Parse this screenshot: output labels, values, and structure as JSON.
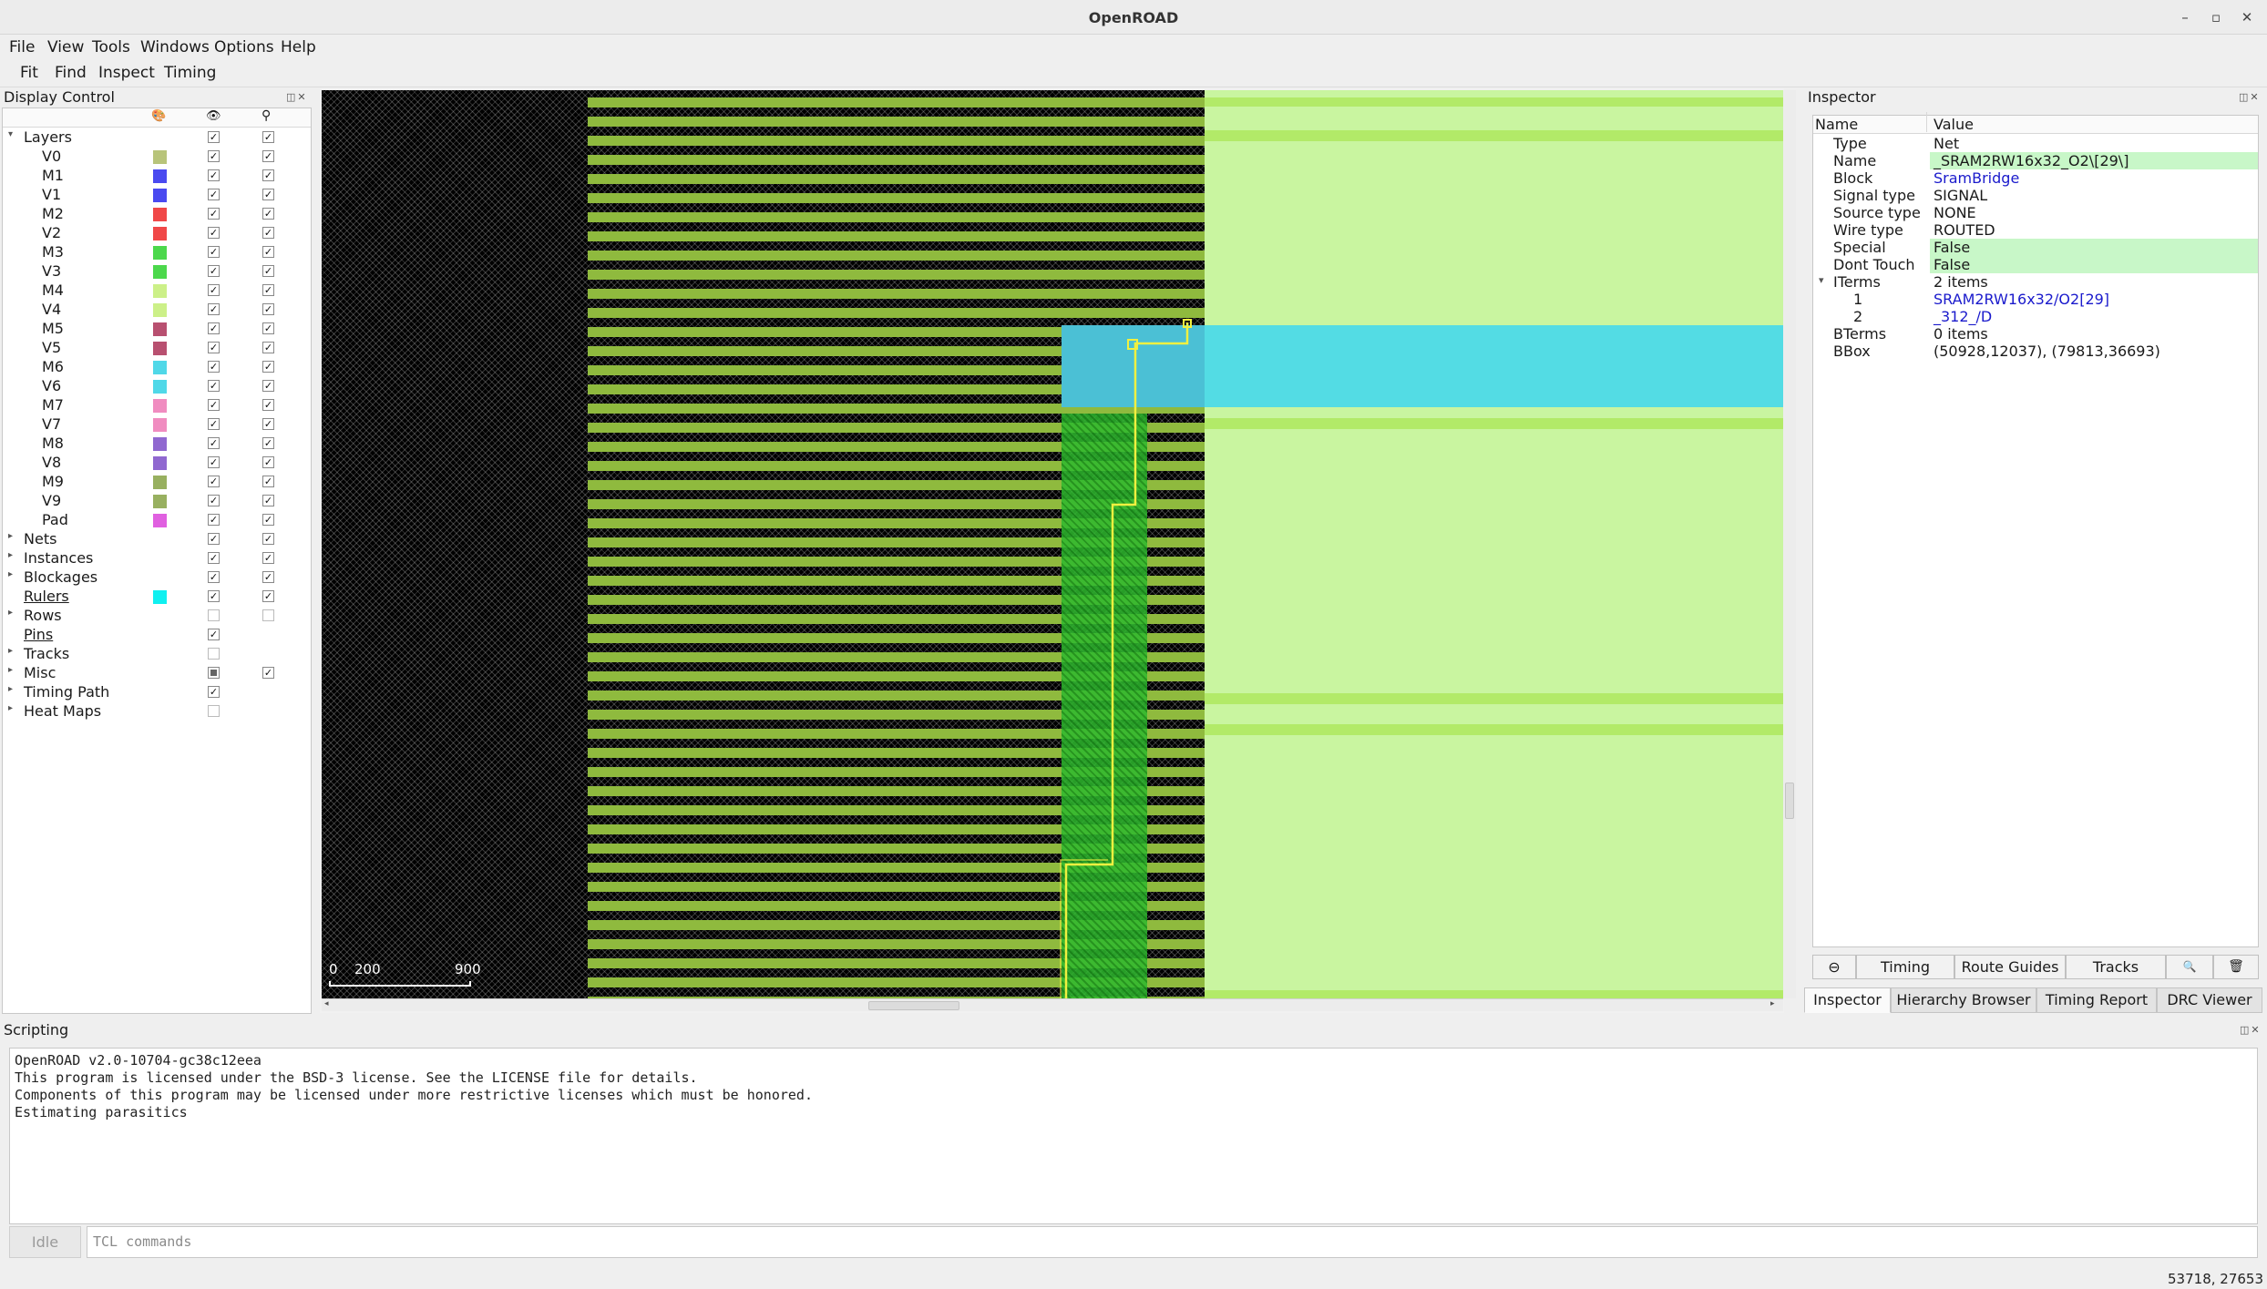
{
  "window": {
    "title": "OpenROAD",
    "controls": [
      "–",
      "▫",
      "✕"
    ]
  },
  "menu": [
    "File",
    "View",
    "Tools",
    "Windows",
    "Options",
    "Help"
  ],
  "toolbar": [
    "Fit",
    "Find",
    "Inspect",
    "Timing"
  ],
  "display_control": {
    "title": "Display Control",
    "dock_buttons": "◫✕",
    "header_icons": [
      "palette-icon",
      "eye-icon",
      "pointer-icon"
    ],
    "header_glyphs": [
      "🎨",
      "👁",
      "⚲"
    ],
    "layers_label": "Layers",
    "layers": [
      {
        "name": "V0",
        "color": "#b8c47a"
      },
      {
        "name": "M1",
        "color": "#4a4af0"
      },
      {
        "name": "V1",
        "color": "#4a4af0"
      },
      {
        "name": "M2",
        "color": "#f04848"
      },
      {
        "name": "V2",
        "color": "#f04848"
      },
      {
        "name": "M3",
        "color": "#4cd84c"
      },
      {
        "name": "V3",
        "color": "#4cd84c"
      },
      {
        "name": "M4",
        "color": "#ccf088"
      },
      {
        "name": "V4",
        "color": "#ccf088"
      },
      {
        "name": "M5",
        "color": "#b85070"
      },
      {
        "name": "V5",
        "color": "#b85070"
      },
      {
        "name": "M6",
        "color": "#50d8e8"
      },
      {
        "name": "V6",
        "color": "#50d8e8"
      },
      {
        "name": "M7",
        "color": "#f08cc0"
      },
      {
        "name": "V7",
        "color": "#f08cc0"
      },
      {
        "name": "M8",
        "color": "#9068d0"
      },
      {
        "name": "V8",
        "color": "#9068d0"
      },
      {
        "name": "M9",
        "color": "#98b060"
      },
      {
        "name": "V9",
        "color": "#98b060"
      },
      {
        "name": "Pad",
        "color": "#e060e0"
      }
    ],
    "groups": [
      {
        "name": "Nets",
        "expandable": true,
        "underline": false,
        "swatch": "",
        "vis": "on",
        "sel": "on"
      },
      {
        "name": "Instances",
        "expandable": true,
        "underline": false,
        "swatch": "",
        "vis": "on",
        "sel": "on"
      },
      {
        "name": "Blockages",
        "expandable": true,
        "underline": false,
        "swatch": "",
        "vis": "on",
        "sel": "on"
      },
      {
        "name": "Rulers",
        "expandable": false,
        "underline": true,
        "swatch": "#10f0f0",
        "vis": "on",
        "sel": "on"
      },
      {
        "name": "Rows",
        "expandable": true,
        "underline": false,
        "swatch": "",
        "vis": "off",
        "sel": "off"
      },
      {
        "name": "Pins",
        "expandable": false,
        "underline": true,
        "swatch": "",
        "vis": "on",
        "sel": "none"
      },
      {
        "name": "Tracks",
        "expandable": true,
        "underline": false,
        "swatch": "",
        "vis": "off",
        "sel": "none"
      },
      {
        "name": "Misc",
        "expandable": true,
        "underline": false,
        "swatch": "",
        "vis": "partial",
        "sel": "on"
      },
      {
        "name": "Timing Path",
        "expandable": true,
        "underline": false,
        "swatch": "",
        "vis": "on",
        "sel": "none"
      },
      {
        "name": "Heat Maps",
        "expandable": true,
        "underline": false,
        "swatch": "",
        "vis": "off",
        "sel": "none"
      }
    ]
  },
  "layout_view": {
    "scale_labels": [
      "0",
      "200",
      "900"
    ],
    "colors": {
      "stripe": "#8fba3e",
      "metal_block": "#c9f5a0",
      "band": "#53dce4",
      "cell": "#2eb82e",
      "net": "#f0f040"
    }
  },
  "inspector": {
    "title": "Inspector",
    "dock_buttons": "◫✕",
    "col_name": "Name",
    "col_value": "Value",
    "rows": [
      {
        "key": "Type",
        "value": "Net",
        "indent": 1,
        "hl": false,
        "link": false,
        "arrow": ""
      },
      {
        "key": "Name",
        "value": "_SRAM2RW16x32_O2\\[29\\]",
        "indent": 1,
        "hl": true,
        "link": false,
        "arrow": ""
      },
      {
        "key": "Block",
        "value": "SramBridge",
        "indent": 1,
        "hl": false,
        "link": true,
        "arrow": ""
      },
      {
        "key": "Signal type",
        "value": "SIGNAL",
        "indent": 1,
        "hl": false,
        "link": false,
        "arrow": ""
      },
      {
        "key": "Source type",
        "value": "NONE",
        "indent": 1,
        "hl": false,
        "link": false,
        "arrow": ""
      },
      {
        "key": "Wire type",
        "value": "ROUTED",
        "indent": 1,
        "hl": false,
        "link": false,
        "arrow": ""
      },
      {
        "key": "Special",
        "value": "False",
        "indent": 1,
        "hl": true,
        "link": false,
        "arrow": ""
      },
      {
        "key": "Dont Touch",
        "value": "False",
        "indent": 1,
        "hl": true,
        "link": false,
        "arrow": ""
      },
      {
        "key": "ITerms",
        "value": "2 items",
        "indent": 1,
        "hl": false,
        "link": false,
        "arrow": "▾"
      },
      {
        "key": "1",
        "value": "SRAM2RW16x32/O2[29]",
        "indent": 2,
        "hl": false,
        "link": true,
        "arrow": ""
      },
      {
        "key": "2",
        "value": "_312_/D",
        "indent": 2,
        "hl": false,
        "link": true,
        "arrow": ""
      },
      {
        "key": "BTerms",
        "value": "0 items",
        "indent": 1,
        "hl": false,
        "link": false,
        "arrow": ""
      },
      {
        "key": "BBox",
        "value": "(50928,12037), (79813,36693)",
        "indent": 1,
        "hl": false,
        "link": false,
        "arrow": ""
      }
    ],
    "actions": {
      "zoom_out": "⊖",
      "timing": "Timing",
      "route_guides": "Route Guides",
      "tracks": "Tracks",
      "search": "🔍",
      "delete": "🗑"
    },
    "tabs": [
      "Inspector",
      "Hierarchy Browser",
      "Timing Report",
      "DRC Viewer"
    ]
  },
  "scripting": {
    "title": "Scripting",
    "dock_buttons": "◫✕",
    "console_lines": [
      "OpenROAD v2.0-10704-gc38c12eea",
      "This program is licensed under the BSD-3 license. See the LICENSE file for details.",
      "Components of this program may be licensed under more restrictive licenses which must be honored.",
      "Estimating parasitics"
    ],
    "idle_label": "Idle",
    "command_placeholder": "TCL commands"
  },
  "status_bar": {
    "coords": "53718, 27653"
  }
}
